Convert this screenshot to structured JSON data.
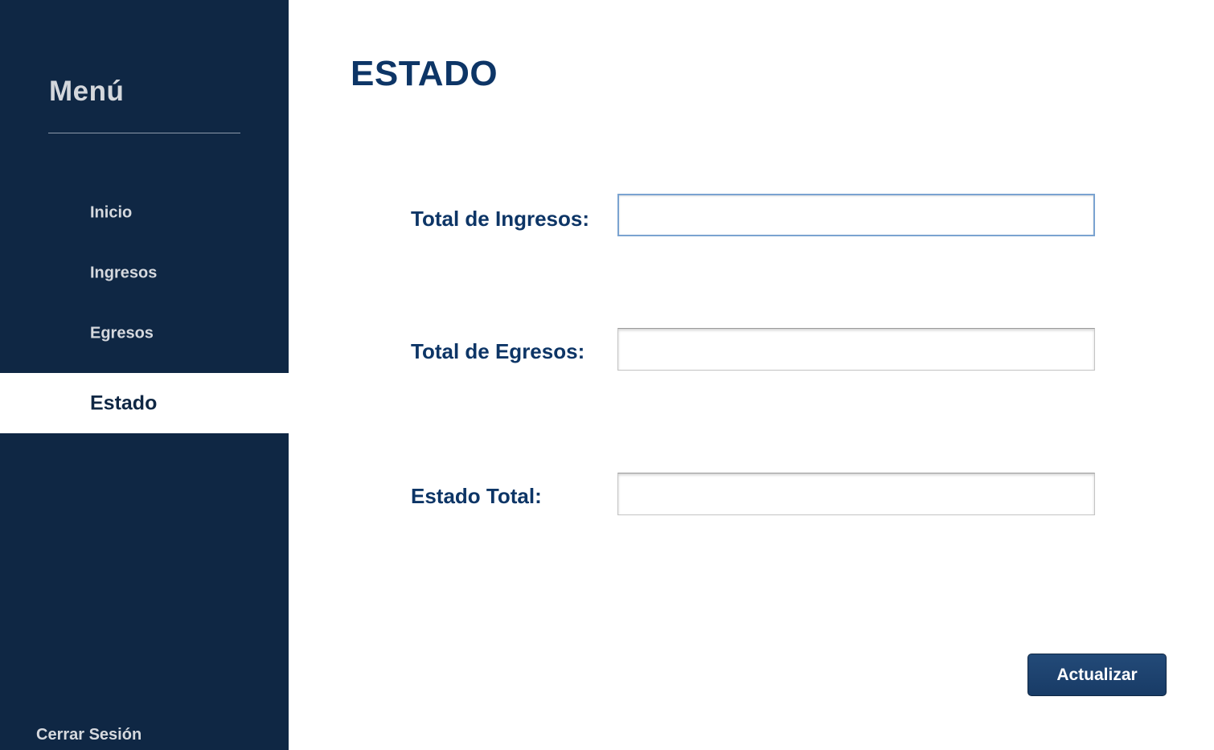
{
  "sidebar": {
    "title": "Menú",
    "items": [
      {
        "label": "Inicio",
        "active": false
      },
      {
        "label": "Ingresos",
        "active": false
      },
      {
        "label": "Egresos",
        "active": false
      },
      {
        "label": "Estado",
        "active": true
      }
    ],
    "logout_label": "Cerrar Sesión"
  },
  "main": {
    "title": "ESTADO",
    "fields": [
      {
        "label": "Total de Ingresos:",
        "value": "",
        "focused": true
      },
      {
        "label": "Total de Egresos:",
        "value": "",
        "focused": false
      },
      {
        "label": "Estado Total:",
        "value": "",
        "focused": false
      }
    ],
    "update_button_label": "Actualizar"
  },
  "colors": {
    "sidebar_bg": "#0f2744",
    "accent": "#0d3566",
    "button_bg": "#1c416e"
  }
}
